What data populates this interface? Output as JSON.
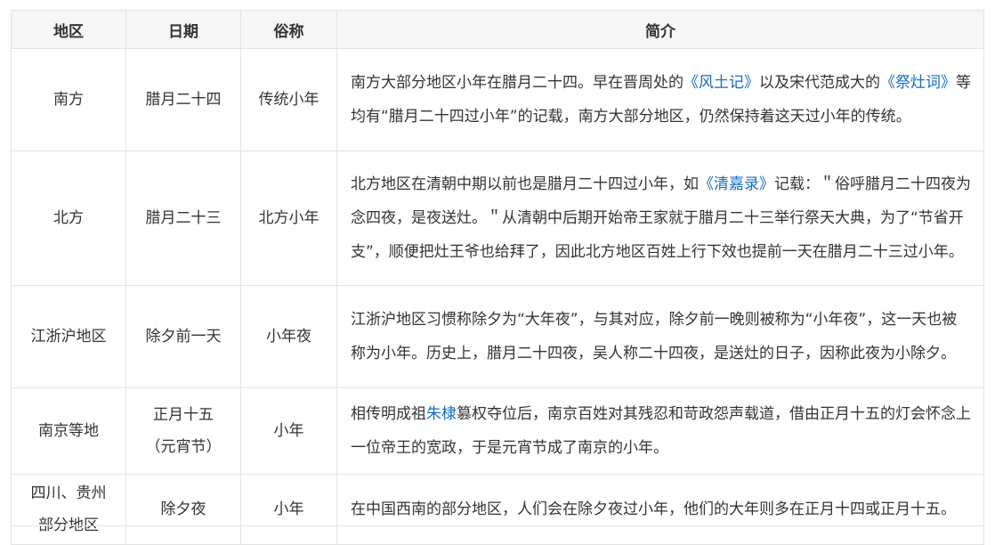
{
  "table": {
    "headers": {
      "region": "地区",
      "date": "日期",
      "name": "俗称",
      "desc": "简介"
    },
    "rows": [
      {
        "region": "南方",
        "date": "腊月二十四",
        "name": "传统小年",
        "desc": {
          "p1": "南方大部分地区小年在腊月二十四。早在晋周处的",
          "link1": "《风土记》",
          "p2": "以及宋代范成大的",
          "link2": "《祭灶词》",
          "p3": "等均有“腊月二十四过小年”的记载，南方大部分地区，仍然保持着这天过小年的传统。"
        }
      },
      {
        "region": "北方",
        "date": "腊月二十三",
        "name": "北方小年",
        "desc": {
          "p1": "北方地区在清朝中期以前也是腊月二十四过小年，如",
          "link1": "《清嘉录》",
          "p2": "记载：＂俗呼腊月二十四夜为念四夜，是夜送灶。＂从清朝中后期开始帝王家就于腊月二十三举行祭天大典，为了“节省开支”，顺便把灶王爷也给拜了，因此北方地区百姓上行下效也提前一天在腊月二十三过小年。"
        }
      },
      {
        "region": "江浙沪地区",
        "date": "除夕前一天",
        "name": "小年夜",
        "desc": {
          "p1": "江浙沪地区习惯称除夕为“大年夜”，与其对应，除夕前一晚则被称为“小年夜”，这一天也被称为小年。历史上，腊月二十四夜，吴人称二十四夜，是送灶的日子，因称此夜为小除夕。"
        }
      },
      {
        "region": "南京等地",
        "date_line1": "正月十五",
        "date_line2": "（元宵节）",
        "name": "小年",
        "desc": {
          "p1": "相传明成祖",
          "link1": "朱棣",
          "p2": "篡权夺位后，南京百姓对其残忍和苛政怨声载道，借由正月十五的灯会怀念上一位帝王的宽政，于是元宵节成了南京的小年。"
        }
      },
      {
        "region_line1": "四川、贵州",
        "region_line2": "部分地区",
        "date": "除夕夜",
        "name": "小年",
        "desc": {
          "p1": "在中国西南的部分地区，人们会在除夕夜过小年，他们的大年则多在正月十四或正月十五。"
        }
      }
    ]
  }
}
